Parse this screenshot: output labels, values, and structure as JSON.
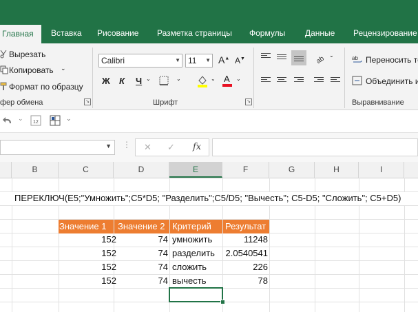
{
  "ribbon_tabs": [
    "Главная",
    "Вставка",
    "Рисование",
    "Разметка страницы",
    "Формулы",
    "Данные",
    "Рецензирование"
  ],
  "clipboard": {
    "cut": "Вырезать",
    "copy": "Копировать",
    "format_painter": "Формат по образцу",
    "group": "фер обмена"
  },
  "font": {
    "name": "Calibri",
    "size": "11",
    "grow": "A",
    "shrink": "A",
    "bold": "Ж",
    "italic": "К",
    "underline": "Ч",
    "group": "Шрифт"
  },
  "alignment": {
    "wrap": "Переносить те",
    "merge": "Объединить и",
    "group": "Выравнивание"
  },
  "formula_bar": {
    "cancel": "✕",
    "enter": "✓",
    "fx": "fx",
    "value": ""
  },
  "columns": [
    "B",
    "C",
    "D",
    "E",
    "F",
    "G",
    "H",
    "I"
  ],
  "selected_column": "E",
  "formula_text": "ПЕРЕКЛЮЧ(E5;\"Умножить\";C5*D5; \"Разделить\";C5/D5; \"Вычесть\"; C5-D5; \"Сложить\"; C5+D5)",
  "table": {
    "headers": [
      "Значение 1",
      "Значение 2",
      "Критерий",
      "Результат"
    ],
    "rows": [
      [
        "152",
        "74",
        "умножить",
        "11248"
      ],
      [
        "152",
        "74",
        "разделить",
        "2.0540541"
      ],
      [
        "152",
        "74",
        "сложить",
        "226"
      ],
      [
        "152",
        "74",
        "вычесть",
        "78"
      ]
    ]
  },
  "colors": {
    "accent": "#217346",
    "header_fill": "#ed7d31"
  }
}
